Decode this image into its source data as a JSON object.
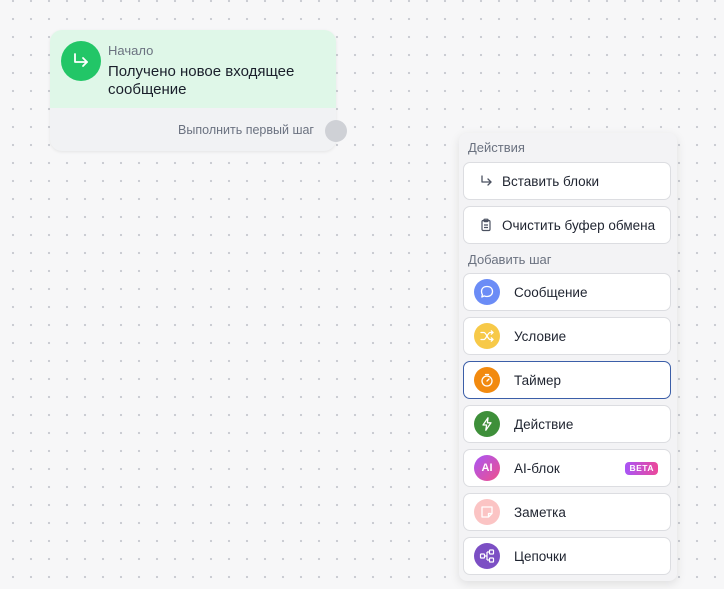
{
  "start_node": {
    "label": "Начало",
    "title": "Получено новое входящее сообщение",
    "footer": "Выполнить первый шаг",
    "accent": "#22c667"
  },
  "menu": {
    "actions_title": "Действия",
    "actions": [
      {
        "label": "Вставить блоки",
        "icon": "return-arrow-icon"
      },
      {
        "label": "Очистить буфер обмена",
        "icon": "clipboard-icon"
      }
    ],
    "add_step_title": "Добавить шаг",
    "steps": [
      {
        "label": "Сообщение",
        "icon": "chat-bubble-icon",
        "color": "#6b8cf6"
      },
      {
        "label": "Условие",
        "icon": "shuffle-icon",
        "color": "#f7c948"
      },
      {
        "label": "Таймер",
        "icon": "stopwatch-icon",
        "color": "#f28a0f",
        "selected": true
      },
      {
        "label": "Действие",
        "icon": "lightning-icon",
        "color": "#3e8f3a"
      },
      {
        "label": "AI-блок",
        "icon": "ai-icon",
        "color": "#d9479e",
        "badge": "BETA",
        "icon_text": "AI"
      },
      {
        "label": "Заметка",
        "icon": "note-icon",
        "color": "#fbc4c4"
      },
      {
        "label": "Цепочки",
        "icon": "chain-nodes-icon",
        "color": "#7c4fc4"
      }
    ]
  }
}
